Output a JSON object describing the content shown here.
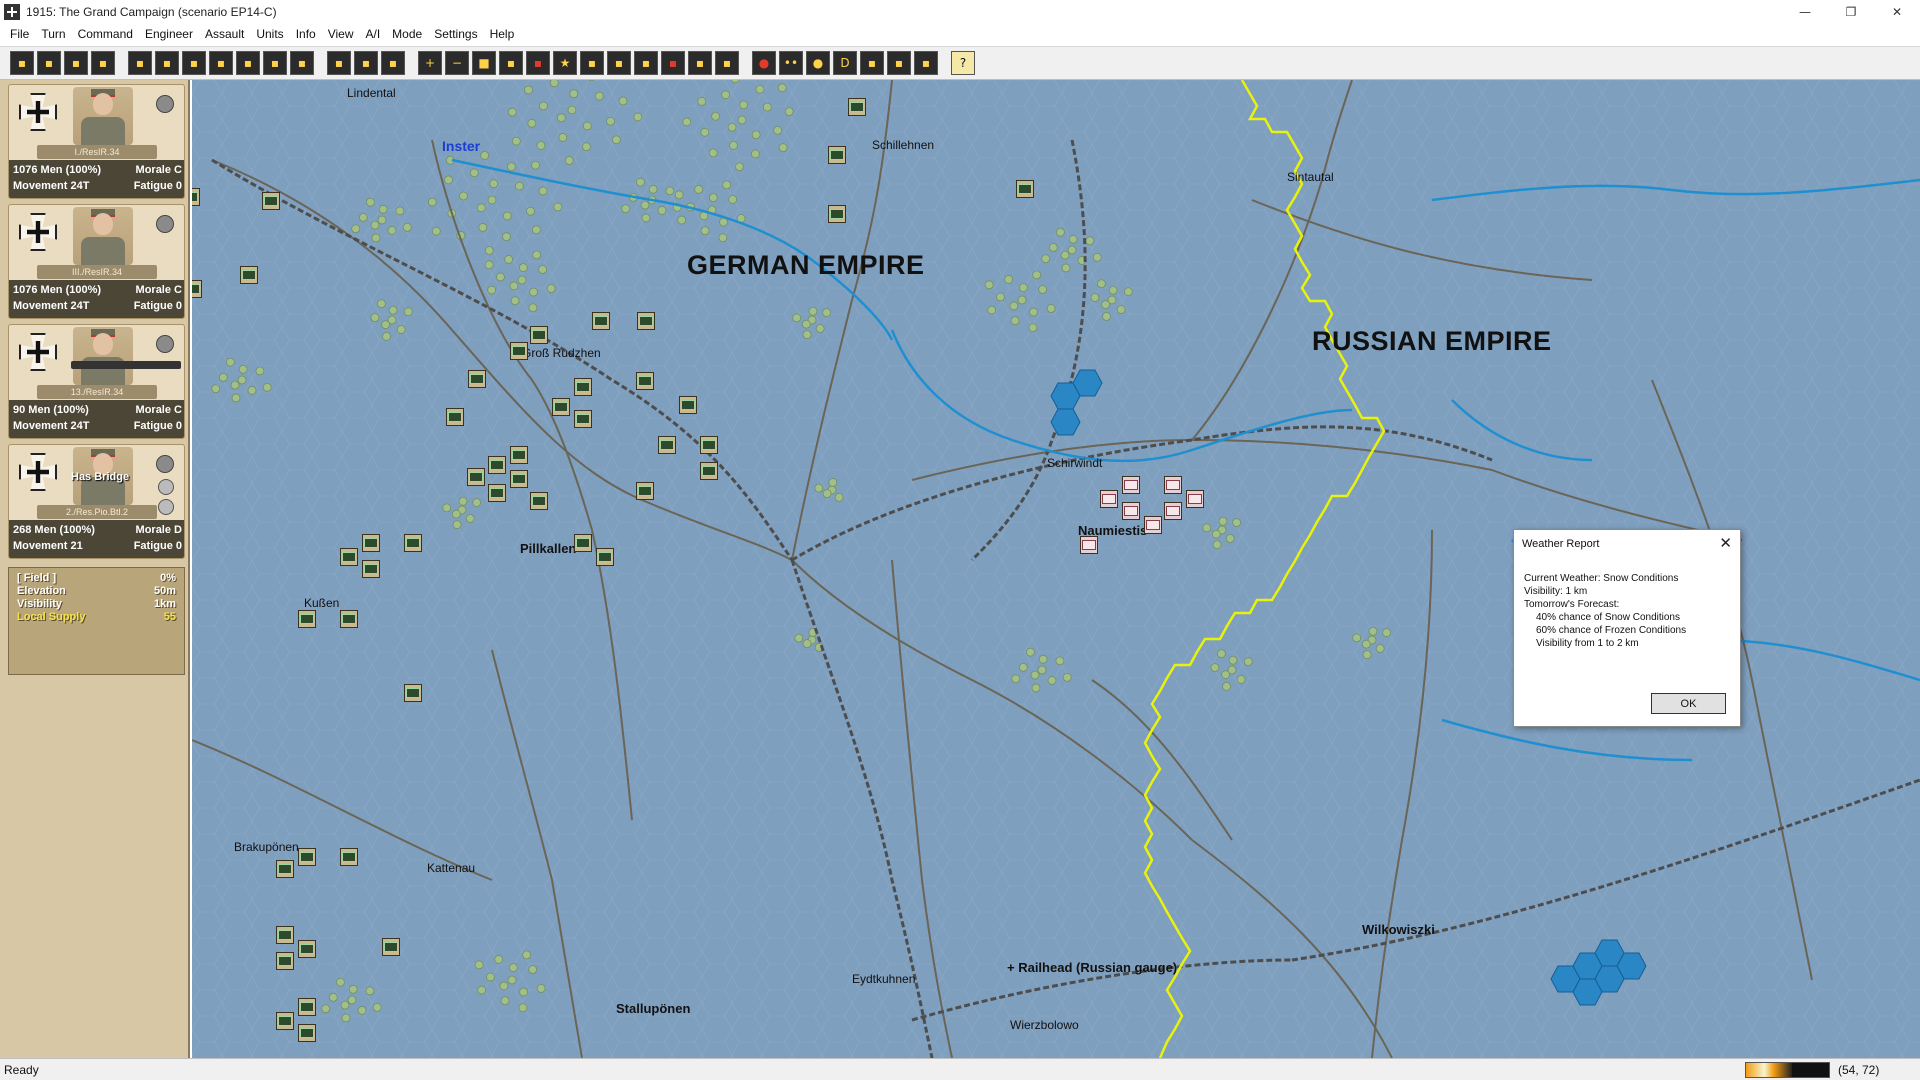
{
  "window": {
    "title": "1915: The Grand Campaign (scenario EP14-C)",
    "minimize_glyph": "—",
    "restore_glyph": "❐",
    "close_glyph": "✕"
  },
  "menu": [
    "File",
    "Turn",
    "Command",
    "Engineer",
    "Assault",
    "Units",
    "Info",
    "View",
    "A/I",
    "Mode",
    "Settings",
    "Help"
  ],
  "toolbar_icons": [
    "swastika-cross-icon",
    "scroll-icon",
    "scroll-icon",
    "save-icon",
    "flag-icon",
    "target-icon",
    "column-icon",
    "ammo-icon",
    "box-icon",
    "cross-icon",
    "plus-cross-icon",
    "explosion-icon",
    "officer-icon",
    "portrait-icon",
    "plus-icon",
    "minus-icon",
    "square-icon",
    "ammo-icon",
    "red-icon",
    "star-icon",
    "bridge-icon",
    "rail-icon",
    "oval-icon",
    "fire-icon",
    "car-icon",
    "unit-icon",
    "red-dot-icon",
    "dots-icon",
    "circle-icon",
    "d-icon",
    "bars-icon",
    "counter-icon",
    "counter-icon",
    "help-icon"
  ],
  "units": [
    {
      "name": "I./ResIR.34",
      "men": "1076 Men (100%)",
      "morale": "Morale C",
      "movement": "Movement 24T",
      "fatigue": "Fatigue 0",
      "special": ""
    },
    {
      "name": "III./ResIR.34",
      "men": "1076 Men (100%)",
      "morale": "Morale C",
      "movement": "Movement 24T",
      "fatigue": "Fatigue 0",
      "special": ""
    },
    {
      "name": "13./ResIR.34",
      "men": "90 Men (100%)",
      "morale": "Morale C",
      "movement": "Movement 24T",
      "fatigue": "Fatigue 0",
      "special": ""
    },
    {
      "name": "2./Res.Pio.Btl.2",
      "men": "268 Men (100%)",
      "morale": "Morale D",
      "movement": "Movement 21",
      "fatigue": "Fatigue 0",
      "special": "Has Bridge"
    }
  ],
  "terrain": {
    "type": "[ Field ]",
    "type_value": "0%",
    "elevation_label": "Elevation",
    "elevation_value": "50m",
    "visibility_label": "Visibility",
    "visibility_value": "1km",
    "supply_label": "Local Supply",
    "supply_value": "55"
  },
  "map_labels": {
    "lindental": "Lindental",
    "inster": "Inster",
    "schillehnen": "Schillehnen",
    "sintautal": "Sintautal",
    "german_empire": "GERMAN EMPIRE",
    "russian_empire": "RUSSIAN EMPIRE",
    "gross_rudzhen": "Groß Rudzhen",
    "schirwindt": "Schirwindt",
    "naumiestis": "Naumiestis",
    "pillkallen": "Pillkallen",
    "kussen": "Kußen",
    "brakuponen": "Brakupönen",
    "kattenau": "Kattenau",
    "eydtkuhnen": "Eydtkuhnen",
    "railhead": "+ Railhead (Russian gauge)",
    "stalluponen": "Stallupönen",
    "wierzbolowo": "Wierzbolowo",
    "wilkowiszki": "Wilkowiszki"
  },
  "weather_dialog": {
    "title": "Weather Report",
    "close_glyph": "✕",
    "lines": [
      "Current Weather: Snow Conditions",
      "Visibility: 1 km",
      "Tomorrow's Forecast:"
    ],
    "forecast": [
      "40% chance of Snow Conditions",
      "60% chance of Frozen Conditions",
      "Visibility from 1 to 2  km"
    ],
    "ok_label": "OK"
  },
  "status": {
    "text": "Ready",
    "coords": "(54, 72)",
    "turn_progress": 0.55
  },
  "colors": {
    "map_base": "#7f9fbf",
    "river": "#1f8fd0",
    "border": "#e8f20a",
    "road": "#6e6a5a",
    "rail": "#5a5a5a",
    "forest": "#8fb27a",
    "lake": "#1f7fbf"
  }
}
